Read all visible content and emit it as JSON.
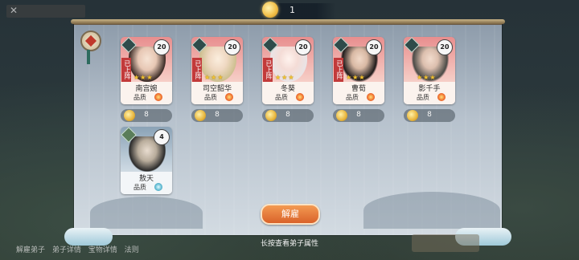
{
  "currency": {
    "icon": "fragment-coin-icon",
    "value": "1"
  },
  "disciples": [
    {
      "name": "南宫婉",
      "level": "20",
      "deployed": "已上阵",
      "quality": "品质",
      "fragments": "8",
      "card_color": "red"
    },
    {
      "name": "司空韶华",
      "level": "20",
      "deployed": "已上阵",
      "quality": "品质",
      "fragments": "8",
      "card_color": "red"
    },
    {
      "name": "冬葵",
      "level": "20",
      "deployed": "已上阵",
      "quality": "品质",
      "fragments": "8",
      "card_color": "red"
    },
    {
      "name": "曹荀",
      "level": "20",
      "deployed": "已上阵",
      "quality": "品质",
      "fragments": "8",
      "card_color": "red"
    },
    {
      "name": "影千手",
      "level": "20",
      "deployed": "",
      "quality": "品质",
      "fragments": "8",
      "card_color": "red"
    },
    {
      "name": "敖天",
      "level": "4",
      "deployed": "",
      "quality": "品质",
      "fragments": "",
      "card_color": "blue"
    }
  ],
  "dismiss_button": "解雇",
  "hint": "长按查看弟子属性",
  "bottom_menu": [
    "解雇弟子",
    "弟子详情",
    "宝物详情",
    "法则"
  ],
  "colors": {
    "accent": "#e2733a",
    "card_red": "#e88e8e",
    "card_blue": "#8aa2b6"
  }
}
